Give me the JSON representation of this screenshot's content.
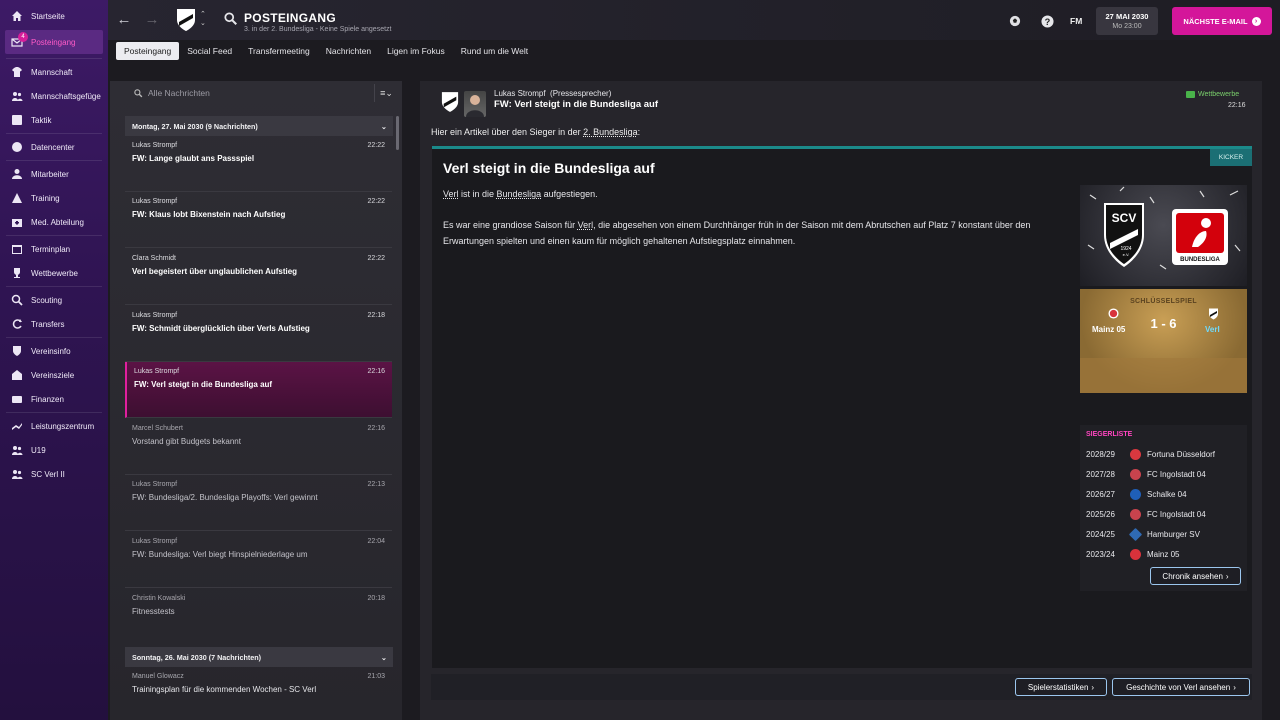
{
  "sidebar": {
    "items": [
      {
        "label": "Startseite",
        "icon": "home-icon"
      },
      {
        "label": "Posteingang",
        "icon": "inbox-icon",
        "badge": "4"
      },
      {
        "label": "Mannschaft",
        "icon": "team-icon"
      },
      {
        "label": "Mannschaftsgefüge",
        "icon": "dynamics-icon"
      },
      {
        "label": "Taktik",
        "icon": "tactics-icon"
      },
      {
        "label": "Datencenter",
        "icon": "data-icon"
      },
      {
        "label": "Mitarbeiter",
        "icon": "staff-icon"
      },
      {
        "label": "Training",
        "icon": "training-icon"
      },
      {
        "label": "Med. Abteilung",
        "icon": "medical-icon"
      },
      {
        "label": "Terminplan",
        "icon": "calendar-icon"
      },
      {
        "label": "Wettbewerbe",
        "icon": "trophy-icon"
      },
      {
        "label": "Scouting",
        "icon": "scouting-icon"
      },
      {
        "label": "Transfers",
        "icon": "transfers-icon"
      },
      {
        "label": "Vereinsinfo",
        "icon": "club-info-icon"
      },
      {
        "label": "Vereinsziele",
        "icon": "club-vision-icon"
      },
      {
        "label": "Finanzen",
        "icon": "finances-icon"
      },
      {
        "label": "Leistungszentrum",
        "icon": "academy-icon"
      },
      {
        "label": "U19",
        "icon": "u19-icon"
      },
      {
        "label": "SC Verl II",
        "icon": "reserve-icon"
      }
    ]
  },
  "header": {
    "title": "POSTEINGANG",
    "subtitle": "3. in der 2. Bundesliga - Keine Spiele angesetzt",
    "date": "27 MAI 2030",
    "time": "Mo 23:00",
    "fm_label": "FM",
    "next_label": "NÄCHSTE E-MAIL"
  },
  "tabs": [
    "Posteingang",
    "Social Feed",
    "Transfermeeting",
    "Nachrichten",
    "Ligen im Fokus",
    "Rund um die Welt"
  ],
  "search": {
    "placeholder": "Alle Nachrichten"
  },
  "groups": [
    {
      "label": "Montag, 27. Mai 2030 (9 Nachrichten)"
    },
    {
      "label": "Sonntag, 26. Mai 2030 (7 Nachrichten)"
    }
  ],
  "messages": [
    {
      "from": "Lukas Strompf",
      "time": "22:22",
      "subject": "FW: Lange glaubt ans Passspiel"
    },
    {
      "from": "Lukas Strompf",
      "time": "22:22",
      "subject": "FW: Klaus lobt Bixenstein nach Aufstieg"
    },
    {
      "from": "Clara Schmidt",
      "time": "22:22",
      "subject": "Verl begeistert über unglaublichen Aufstieg"
    },
    {
      "from": "Lukas Strompf",
      "time": "22:18",
      "subject": "FW: Schmidt überglücklich über Verls Aufstieg"
    },
    {
      "from": "Lukas Strompf",
      "time": "22:16",
      "subject": "FW: Verl steigt in die Bundesliga auf"
    },
    {
      "from": "Marcel Schubert",
      "time": "22:16",
      "subject": "Vorstand gibt Budgets bekannt"
    },
    {
      "from": "Lukas Strompf",
      "time": "22:13",
      "subject": "FW: Bundesliga/2. Bundesliga Playoffs: Verl gewinnt"
    },
    {
      "from": "Lukas Strompf",
      "time": "22:04",
      "subject": "FW: Bundesliga: Verl biegt Hinspielniederlage um"
    },
    {
      "from": "Christin Kowalski",
      "time": "20:18",
      "subject": "Fitnesstests"
    },
    {
      "from": "Manuel Glowacz",
      "time": "21:03",
      "subject": "Trainingsplan für die kommenden Wochen - SC Verl"
    }
  ],
  "detail": {
    "author": "Lukas Strompf",
    "role": "(Pressesprecher)",
    "subject": "FW: Verl steigt in die Bundesliga auf",
    "competition": "Wettbewerbe",
    "time": "22:16",
    "intro_pre": "Hier ein Artikel über den Sieger in der ",
    "intro_link": "2. Bundesliga",
    "intro_post": ":",
    "source": "KICKER",
    "article_title": "Verl steigt in die Bundesliga auf",
    "p1_link1": "Verl",
    "p1_mid": " ist in die ",
    "p1_link2": "Bundesliga",
    "p1_post": " aufgestiegen.",
    "p2_pre": "Es war eine grandiose Saison für ",
    "p2_link": "Verl",
    "p2_post": ", die abgesehen von einem Durchhänger früh in der Saison mit dem Abrutschen auf Platz 7 konstant über den Erwartungen spielten und einen kaum für möglich gehaltenen Aufstiegsplatz einnahmen."
  },
  "image_labels": {
    "crest_text": "SCV",
    "crest_year": "1924",
    "crest_ev": "e.V.",
    "league_label": "BUNDESLIGA"
  },
  "key_match": {
    "title": "SCHLÜSSELSPIEL",
    "home": "Mainz 05",
    "away": "Verl",
    "score": "1 - 6"
  },
  "winners": {
    "title": "SIEGERLISTE",
    "rows": [
      {
        "season": "2028/29",
        "club": "Fortuna Düsseldorf",
        "color": "#d9383f"
      },
      {
        "season": "2027/28",
        "club": "FC Ingolstadt 04",
        "color": "#c8434d"
      },
      {
        "season": "2026/27",
        "club": "Schalke 04",
        "color": "#1f5fb8"
      },
      {
        "season": "2025/26",
        "club": "FC Ingolstadt 04",
        "color": "#c8434d"
      },
      {
        "season": "2024/25",
        "club": "Hamburger SV",
        "color": "#2f6ab4"
      },
      {
        "season": "2023/24",
        "club": "Mainz 05",
        "color": "#d8323b"
      }
    ],
    "more_label": "Chronik ansehen"
  },
  "buttons": {
    "player_stats": "Spielerstatistiken",
    "history": "Geschichte von Verl ansehen"
  }
}
